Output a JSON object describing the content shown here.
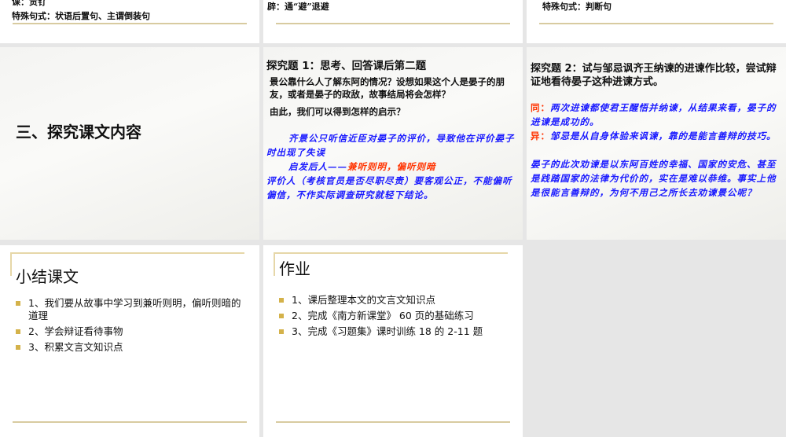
{
  "row1": {
    "slide1": {
      "line1": "课：贡钌",
      "line2": "特殊句式：状语后置句、主谓倒装句"
    },
    "slide2": {
      "line1": "辟：通“避”退避"
    },
    "slide3": {
      "line1": "特殊句式：判断句"
    }
  },
  "section_slide": {
    "title": "三、探究课文内容"
  },
  "q1": {
    "title": "探究题 1：思考、回答课后第二题",
    "question": "景公靠什么人了解东阿的情况？设想如果这个人是晏子的朋友，或者是晏子的政敌，故事结局将会怎样？",
    "prompt": "由此，我们可以得到怎样的启示？",
    "answer1": "齐景公只听信近臣对晏子的评价，导致他在评价晏子时出现了失误",
    "answer2_prefix": "启发后人——",
    "answer2_red": "兼听则明，偏听则暗",
    "answer3": "评价人（考核官员是否尽职尽责）要客观公正，不能偏听偏信，不作实际调查研究就轻下结论。"
  },
  "q2": {
    "title": "探究题 2：试与邹忌讽齐王纳谏的进谏作比较，尝试辩证地看待晏子这种进谏方式。",
    "same_label": "同：",
    "same_text": "两次进谏都使君王醒悟并纳谏，从结果来看，晏子的进谏是成功的。",
    "diff_label": "异：",
    "diff_text": "邹忌是从自身体验来讽谏，靠的是能言善辩的技巧。",
    "extra": "晏子的此次劝谏是以东阿百姓的幸福、国家的安危、甚至是践踏国家的法律为代价的，实在是难以恭维。事实上他是很能言善辩的，为何不用己之所长去劝谏景公呢？"
  },
  "summary": {
    "title": "小结课文",
    "items": [
      "1、我们要从故事中学习到兼听则明，偏听则暗的道理",
      "2、学会辩证看待事物",
      "3、积累文言文知识点"
    ]
  },
  "homework": {
    "title": "作业",
    "items": [
      "1、课后整理本文的文言文知识点",
      "2、完成《南方新课堂》 60 页的基础练习",
      "3、完成《习题集》课时训练 18  的 2-11 题"
    ]
  }
}
